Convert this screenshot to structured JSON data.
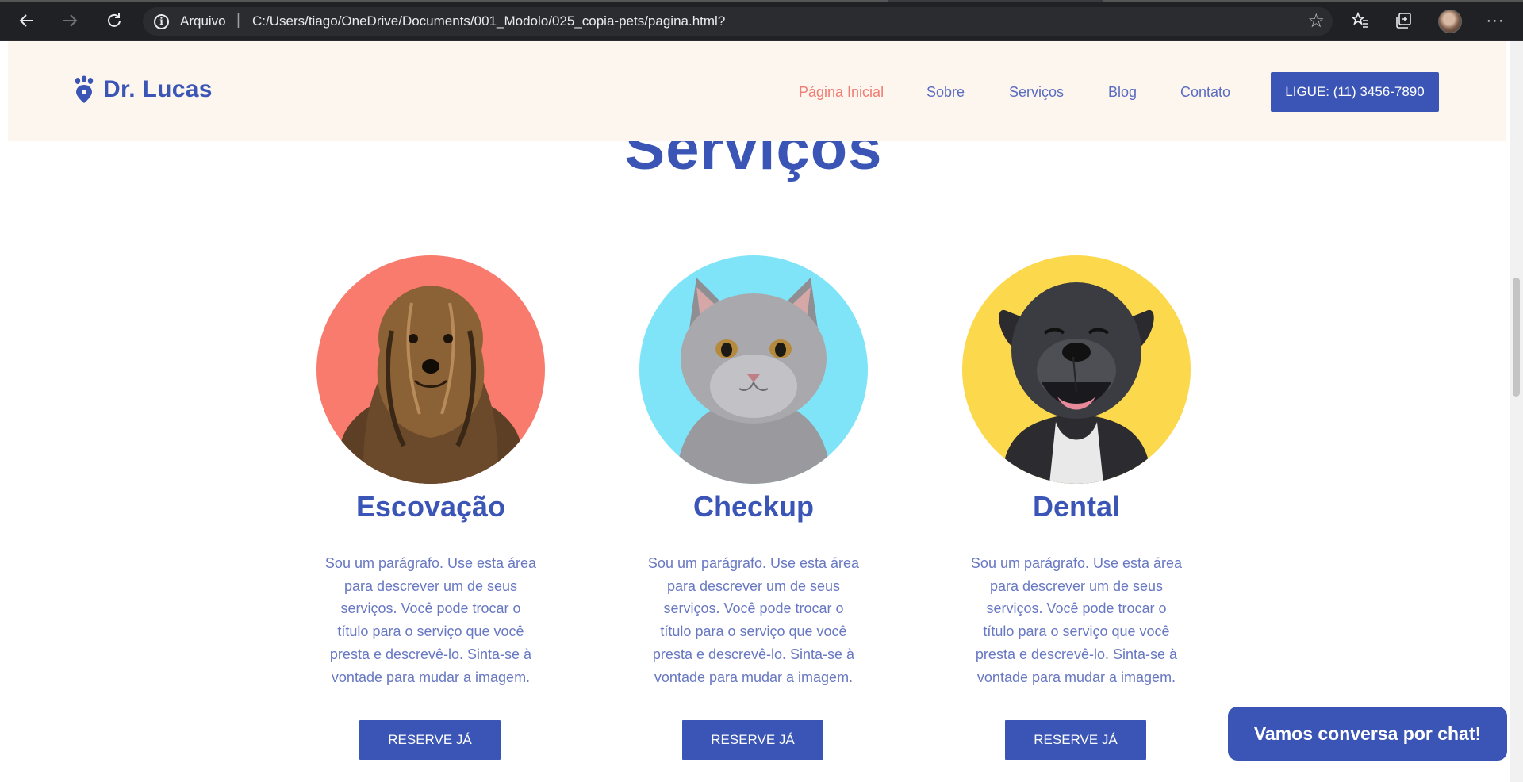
{
  "browser": {
    "protocol_label": "Arquivo",
    "url": "C:/Users/tiago/OneDrive/Documents/001_Modolo/025_copia-pets/pagina.html?",
    "icons": [
      "back-arrow-icon",
      "forward-arrow-icon",
      "reload-icon",
      "info-icon",
      "add-favorite-icon",
      "favorites-icon",
      "collections-icon",
      "profile-avatar",
      "more-menu-icon"
    ]
  },
  "header": {
    "logo_text": "Dr. Lucas",
    "nav": [
      "Página Inicial",
      "Sobre",
      "Serviços",
      "Blog",
      "Contato"
    ],
    "active_nav": "Página Inicial",
    "cta_label": "LIGUE: (11) 3456-7890"
  },
  "services": {
    "title": "Serviços",
    "cards": [
      {
        "title": "Escovação",
        "text": "Sou um parágrafo. Use esta área para descrever um de seus serviços. Você pode trocar o título para o serviço que você presta e descrevê-lo. Sinta-se à vontade para mudar a imagem.",
        "button": "RESERVE JÁ",
        "circle_color": "#f87b6e",
        "image": "yorkshire-terrier"
      },
      {
        "title": "Checkup",
        "text": "Sou um parágrafo. Use esta área para descrever um de seus serviços. Você pode trocar o título para o serviço que você presta e descrevê-lo. Sinta-se à vontade para mudar a imagem.",
        "button": "RESERVE JÁ",
        "circle_color": "#7fe4f7",
        "image": "grey-kitten"
      },
      {
        "title": "Dental",
        "text": "Sou um parágrafo. Use esta área para descrever um de seus serviços. Você pode trocar o título para o serviço que você presta e descrevê-lo. Sinta-se à vontade para mudar a imagem.",
        "button": "RESERVE JÁ",
        "circle_color": "#fcd84c",
        "image": "smiling-black-dog"
      }
    ]
  },
  "chat": {
    "label": "Vamos conversa por chat!"
  },
  "colors": {
    "brand_blue": "#3a55b5",
    "accent_coral": "#f07c73",
    "header_bg": "#fdf6ee"
  }
}
